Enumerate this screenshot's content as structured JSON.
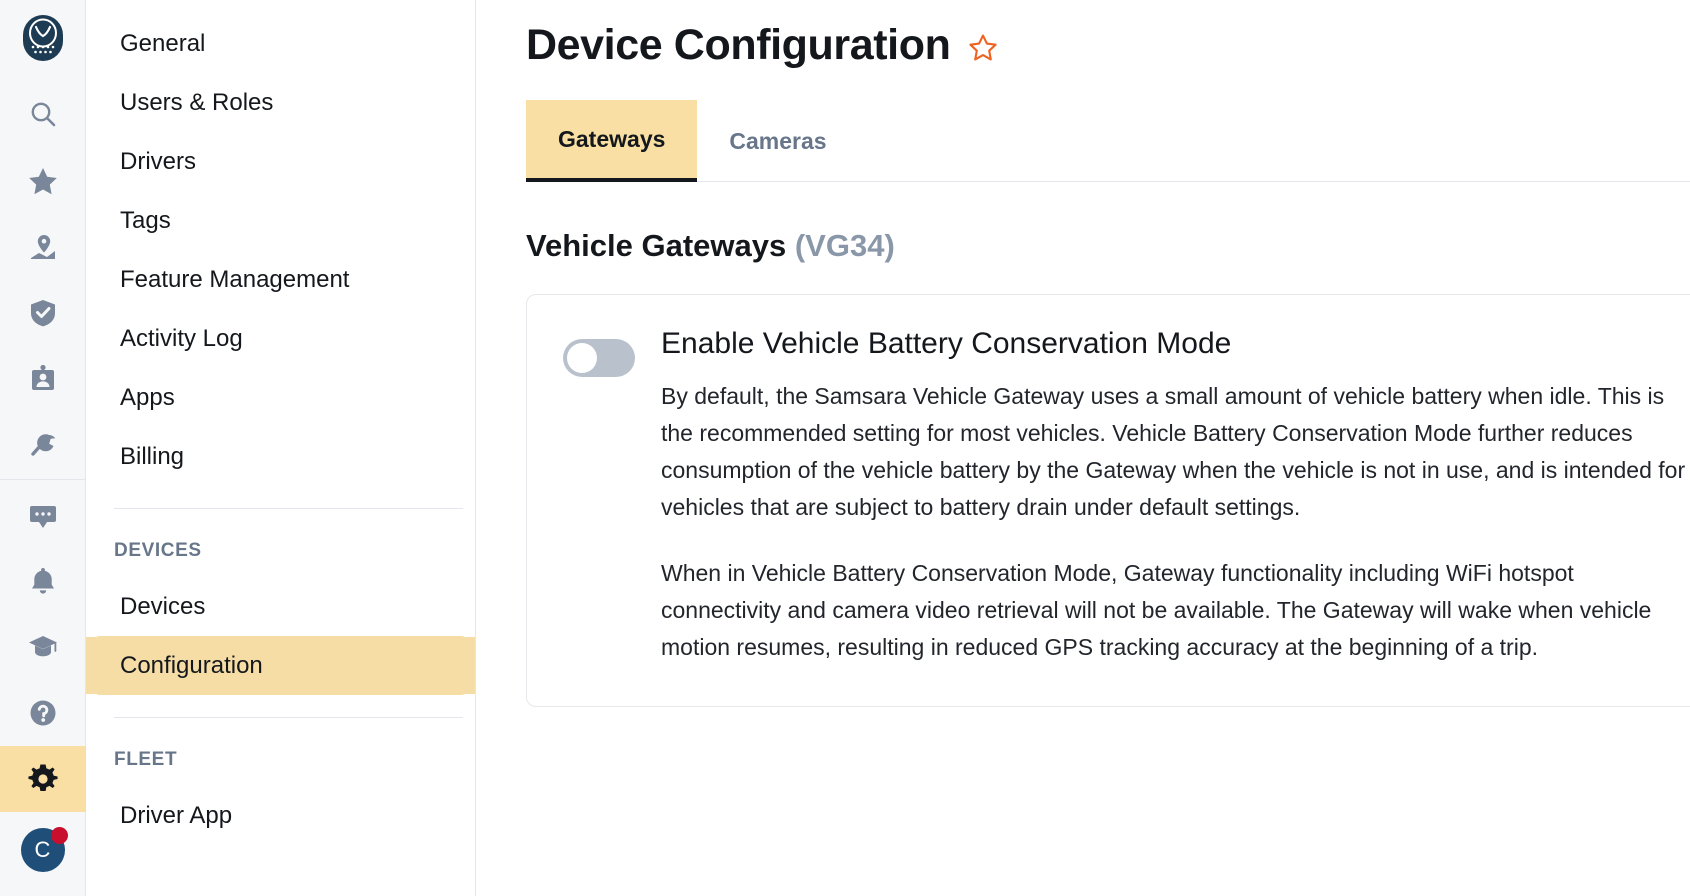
{
  "rail": {
    "logo_name": "samsara-owl-logo",
    "items": [
      {
        "icon": "search-icon",
        "label": "Search"
      },
      {
        "icon": "star-icon",
        "label": "Favorites"
      },
      {
        "icon": "map-pin-icon",
        "label": "Map"
      },
      {
        "icon": "shield-check-icon",
        "label": "Safety"
      },
      {
        "icon": "id-badge-icon",
        "label": "Drivers"
      },
      {
        "icon": "wrench-icon",
        "label": "Maintenance"
      },
      {
        "icon": "chat-icon",
        "label": "Messages"
      },
      {
        "icon": "bell-icon",
        "label": "Alerts"
      },
      {
        "icon": "graduation-cap-icon",
        "label": "Training"
      },
      {
        "icon": "help-circle-icon",
        "label": "Help"
      },
      {
        "icon": "gear-icon",
        "label": "Settings"
      }
    ],
    "avatar_initial": "C",
    "notification_badge": ""
  },
  "sidebar": {
    "items": [
      {
        "label": "General"
      },
      {
        "label": "Users & Roles"
      },
      {
        "label": "Drivers"
      },
      {
        "label": "Tags"
      },
      {
        "label": "Feature Management"
      },
      {
        "label": "Activity Log"
      },
      {
        "label": "Apps"
      },
      {
        "label": "Billing"
      }
    ],
    "group_devices_title": "DEVICES",
    "devices_items": [
      {
        "label": "Devices"
      },
      {
        "label": "Configuration"
      }
    ],
    "group_fleet_title": "FLEET",
    "fleet_items": [
      {
        "label": "Driver App"
      }
    ]
  },
  "header": {
    "title": "Device Configuration",
    "favorite_icon": "star-outline-icon"
  },
  "tabs": [
    {
      "label": "Gateways",
      "active": true
    },
    {
      "label": "Cameras",
      "active": false
    }
  ],
  "section": {
    "title": "Vehicle Gateways",
    "model": "(VG34)"
  },
  "setting": {
    "toggle_state": "off",
    "title": "Enable Vehicle Battery Conservation Mode",
    "paragraph1": "By default, the Samsara Vehicle Gateway uses a small amount of vehicle battery when idle. This is the recommended setting for most vehicles. Vehicle Battery Conservation Mode further reduces consumption of the vehicle battery by the Gateway when the vehicle is not in use, and is intended for vehicles that are subject to battery drain under default settings.",
    "paragraph2": "When in Vehicle Battery Conservation Mode, Gateway functionality including WiFi hotspot connectivity and camera video retrieval will not be available. The Gateway will wake when vehicle motion resumes, resulting in reduced GPS tracking accuracy at the beginning of a trip."
  },
  "colors": {
    "accent_amber": "#fadfa4",
    "accent_amber_nav": "#f6dda6",
    "star_orange": "#ef6321",
    "icon_gray": "#7a8699",
    "text_dark": "#14171c",
    "muted": "#8a97a8",
    "avatar_blue": "#1f4e79",
    "badge_red": "#c8102e"
  }
}
